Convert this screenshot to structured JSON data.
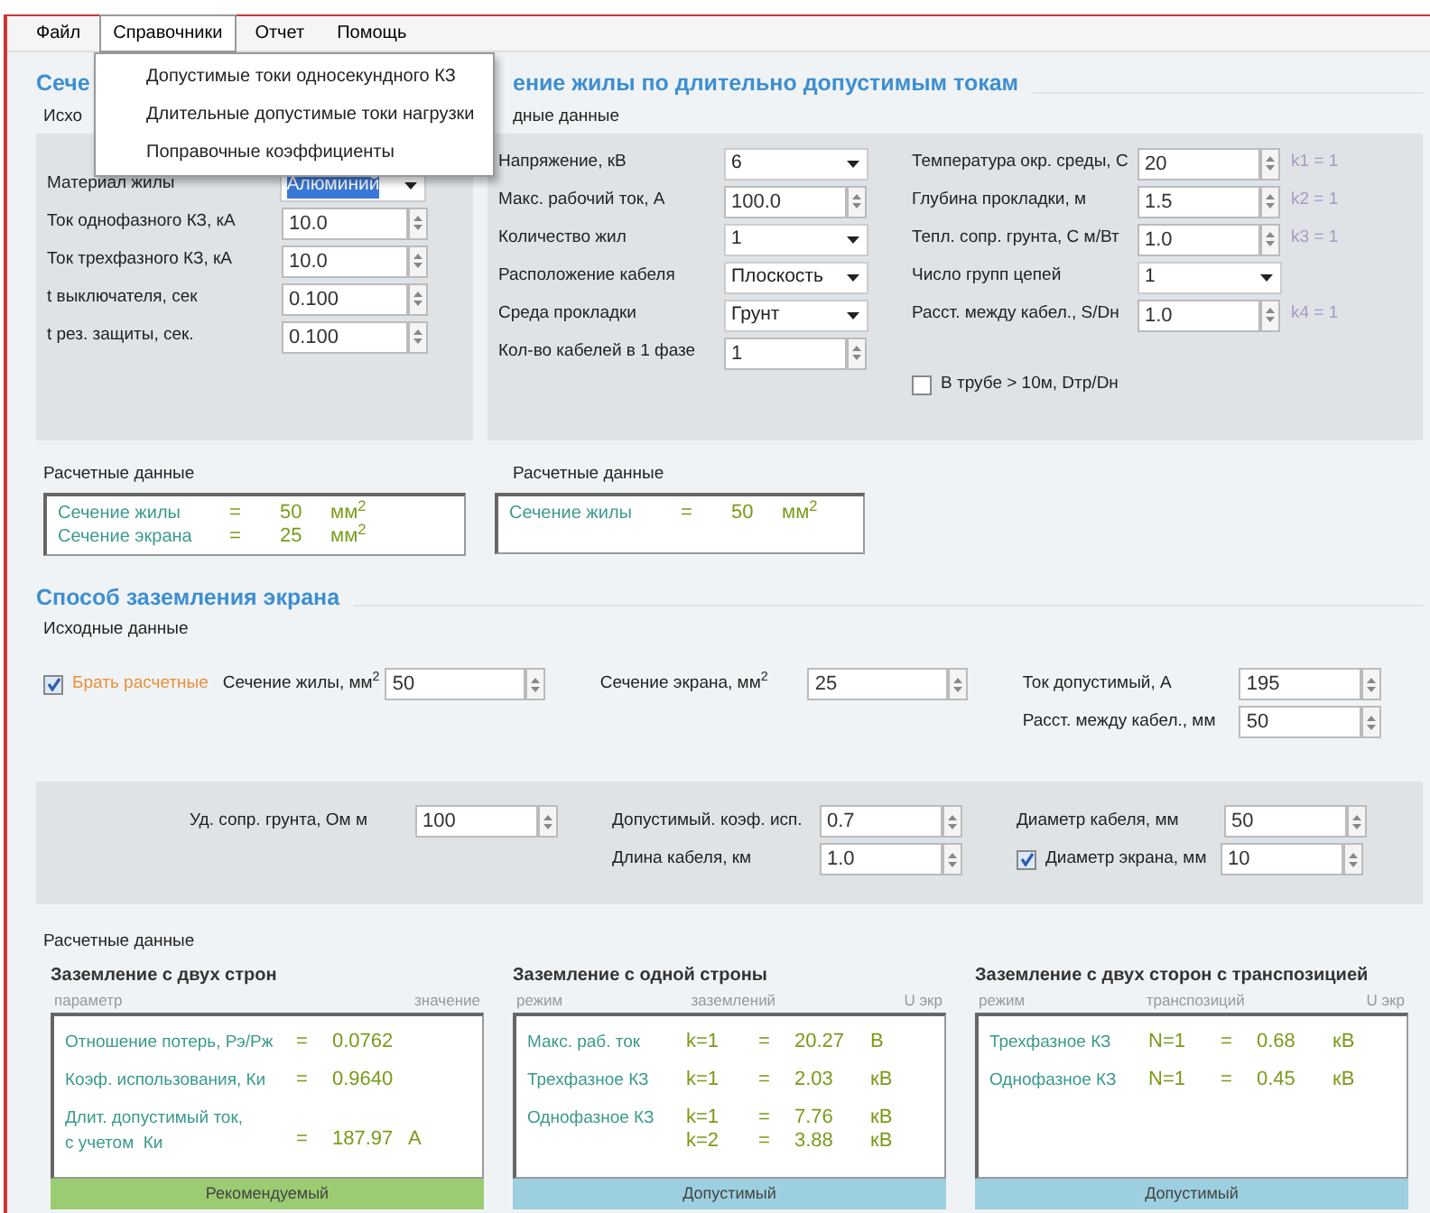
{
  "menu": [
    {
      "label": "Файл",
      "open": false
    },
    {
      "label": "Справочники",
      "open": true
    },
    {
      "label": "Отчет",
      "open": false
    },
    {
      "label": "Помощь",
      "open": false
    }
  ],
  "dropdown": [
    "Допустимые токи односекундного КЗ",
    "Длительные допустимые токи нагрузки",
    "Поправочные коэффициенты"
  ],
  "section1": {
    "title": "Сече",
    "input_label": "Исхо",
    "fields": [
      {
        "label": "Материал жилы",
        "kind": "combo",
        "value": "Алюминий",
        "highlighted": true
      },
      {
        "label": "Ток однофазного КЗ, кА",
        "kind": "spin",
        "value": "10.0"
      },
      {
        "label": "Ток трехфазного КЗ, кА",
        "kind": "spin",
        "value": "10.0"
      },
      {
        "label": "t выключателя, сек",
        "kind": "spin",
        "value": "0.100"
      },
      {
        "label": "t рез. защиты, сек.",
        "kind": "spin",
        "value": "0.100"
      }
    ],
    "results_label": "Расчетные данные",
    "results": [
      {
        "label": "Сечение жилы",
        "eq": "=",
        "value": "50",
        "unit": "мм$^{2}$"
      },
      {
        "label": "Сечение экрана",
        "eq": "=",
        "value": "25",
        "unit": "мм$^{2}$"
      }
    ]
  },
  "section2": {
    "title": "ение жилы по длительно допустимым токам",
    "input_label": "дные данные",
    "fields_left": [
      {
        "label": "Напряжение, кВ",
        "kind": "combo",
        "value": "6",
        "highlighted": false
      },
      {
        "label": "Макс. рабочий ток, А",
        "kind": "spin",
        "value": "100.0"
      },
      {
        "label": "Количество жил",
        "kind": "combo",
        "value": "1",
        "highlighted": false
      },
      {
        "label": "Расположение кабеля",
        "kind": "combo",
        "value": "Плоскость",
        "highlighted": false
      },
      {
        "label": "Среда прокладки",
        "kind": "combo",
        "value": "Грунт",
        "highlighted": false
      },
      {
        "label": "Кол-во кабелей в 1 фазе",
        "kind": "spin",
        "value": "1"
      }
    ],
    "fields_right": [
      {
        "label": "Температура окр. среды, С",
        "kind": "spin",
        "value": "20",
        "note": "k1 = 1"
      },
      {
        "label": "Глубина прокладки, м",
        "kind": "spin",
        "value": "1.5",
        "note": "k2 = 1"
      },
      {
        "label": "Тепл. сопр. грунта, С м/Вт",
        "kind": "spin",
        "value": "1.0",
        "note": "k3 = 1"
      },
      {
        "label": "Число групп цепей",
        "kind": "combo",
        "value": "1",
        "highlighted": false
      },
      {
        "label": "Расст. между кабел., S/Dн",
        "kind": "spin",
        "value": "1.0",
        "note": "k4 = 1"
      }
    ],
    "checkbox": {
      "label": "В трубе > 10м, Dтр/Dн",
      "checked": false
    },
    "results_label": "Расчетные данные",
    "results": [
      {
        "label": "Сечение жилы",
        "eq": "=",
        "value": "50",
        "unit": "мм$^{2}$"
      }
    ]
  },
  "section3": {
    "title": "Способ заземления экрана",
    "input_label": "Исходные данные",
    "checkbox": {
      "label": "Брать расчетные",
      "checked": true
    },
    "top": [
      [
        {
          "label": "Сечение жилы, мм$^{2}$",
          "kind": "spin",
          "value": "50"
        }
      ],
      [
        {
          "label": "Сечение экрана, мм$^{2}$",
          "kind": "spin",
          "value": "25"
        }
      ],
      [
        {
          "label": "Ток допустимый, А",
          "kind": "spin",
          "value": "195"
        },
        {
          "label": "Расст. между кабел., мм",
          "kind": "spin",
          "value": "50"
        }
      ]
    ],
    "bottom": [
      [
        {
          "label": "Уд. сопр. грунта, Ом м",
          "kind": "spin",
          "value": "100"
        }
      ],
      [
        {
          "label": "Допустимый. коэф. исп.",
          "kind": "spin",
          "value": "0.7"
        },
        {
          "label": "Длина кабеля, км",
          "kind": "spin",
          "value": "1.0"
        }
      ],
      [
        {
          "label": "Диаметр кабеля, мм",
          "kind": "spin",
          "value": "50"
        },
        {
          "label": "Диаметр экрана, мм",
          "kind": "spin",
          "value": "10",
          "checked": true
        }
      ]
    ],
    "results_label": "Расчетные данные",
    "panels": [
      {
        "title": "Заземление с двух строн",
        "columns": [
          "параметр",
          "значение"
        ],
        "rows": [
          {
            "label": "Отношение потерь, Рэ/Рж",
            "lines": [
              {
                "eq": "=",
                "value": "0.0762"
              }
            ]
          },
          {
            "label": "Коэф. использования, Ки",
            "lines": [
              {
                "eq": "=",
                "value": "0.9640"
              }
            ]
          },
          {
            "label": "Длит. допустимый ток,\nс учетом  Ки",
            "lines": [
              {
                "eq": "=",
                "value": "187.97",
                "unit": "А"
              }
            ]
          }
        ],
        "footer": "Рекомендуемый",
        "color": "#9ccc72"
      },
      {
        "title": "Заземление с одной строны",
        "columns": [
          "режим",
          "заземлений",
          "U экр"
        ],
        "rows": [
          {
            "label": "Макс. раб. ток",
            "lines": [
              {
                "k": "k=1",
                "eq": "=",
                "value": "20.27",
                "unit": "В"
              }
            ]
          },
          {
            "label": "Трехфазное КЗ",
            "lines": [
              {
                "k": "k=1",
                "eq": "=",
                "value": "2.03",
                "unit": "кВ"
              }
            ]
          },
          {
            "label": "Однофазное КЗ",
            "lines": [
              {
                "k": "k=1",
                "eq": "=",
                "value": "7.76",
                "unit": "кВ"
              },
              {
                "k": "k=2",
                "eq": "=",
                "value": "3.88",
                "unit": "кВ"
              }
            ]
          }
        ],
        "footer": "Допустимый",
        "color": "#9cd0e0"
      },
      {
        "title": "Заземление с двух сторон с транспозицией",
        "columns": [
          "режим",
          "транспозиций",
          "U экр"
        ],
        "rows": [
          {
            "label": "Трехфазное КЗ",
            "lines": [
              {
                "k": "N=1",
                "eq": "=",
                "value": "0.68",
                "unit": "кВ"
              }
            ]
          },
          {
            "label": "Однофазное КЗ",
            "lines": [
              {
                "k": "N=1",
                "eq": "=",
                "value": "0.45",
                "unit": "кВ"
              }
            ]
          }
        ],
        "footer": "Допустимый",
        "color": "#9cd0e0"
      }
    ]
  }
}
